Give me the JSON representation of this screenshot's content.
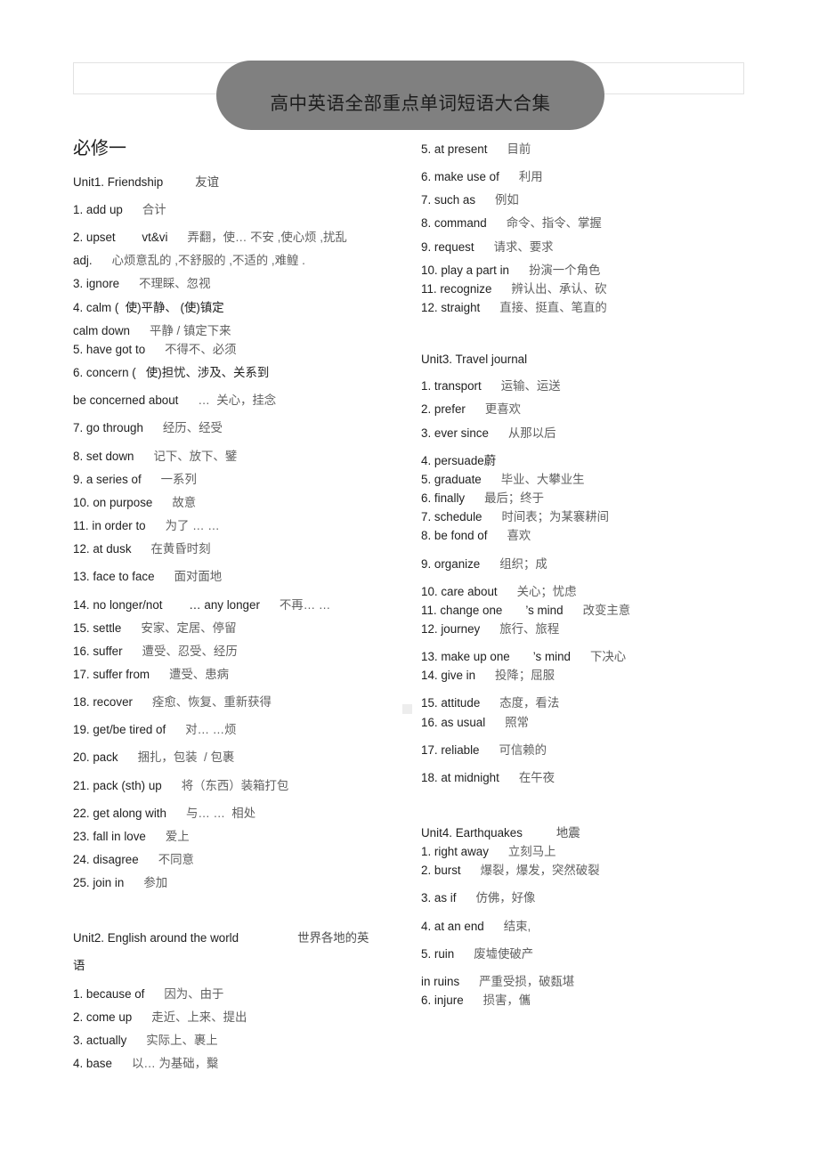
{
  "document": {
    "title_banner": "高中英语全部重点单词短语大合集",
    "banner_color": "#808080",
    "section_heading": "必修一"
  },
  "left_column": {
    "unit1": {
      "heading_en": "Unit1. Friendship",
      "heading_zh": "友谊",
      "entries": [
        {
          "en": "1. add up",
          "zh": "合计",
          "gap": "md"
        },
        {
          "en": "2. upset        vt&vi",
          "zh": "弄翻，使… 不安 ,使心烦 ,扰乱",
          "gap": "md"
        },
        {
          "en": "adj.",
          "zh": "心烦意乱的 ,不舒服的 ,不适的 ,难鳇 .",
          "gap": "sm"
        },
        {
          "en": "3. ignore",
          "zh": "不理睬、忽视",
          "gap": "sm"
        },
        {
          "en": "4. calm (  使)平静、 (使)镇定",
          "zh": "",
          "gap": "sm"
        },
        {
          "en": "calm down",
          "zh": "平静 / 镇定下来",
          "gap": "sm"
        },
        {
          "en": "5. have got to",
          "zh": "不得不、必须",
          "gap": "xs"
        },
        {
          "en": "6. concern (   使)担忧、涉及、关系到",
          "zh": "",
          "gap": "sm"
        },
        {
          "en": "be concerned about",
          "zh": "…  关心，挂念",
          "gap": "md"
        },
        {
          "en": "7. go through",
          "zh": "经历、经受",
          "gap": "md"
        },
        {
          "en": "8. set down",
          "zh": "记下、放下、鐾",
          "gap": "md"
        },
        {
          "en": "9. a series of",
          "zh": "一系列",
          "gap": "sm"
        },
        {
          "en": "10. on purpose",
          "zh": "故意",
          "gap": "sm"
        },
        {
          "en": "11. in order to",
          "zh": "为了 … …",
          "gap": "sm"
        },
        {
          "en": "12. at dusk",
          "zh": "在黄昏时刻",
          "gap": "sm"
        },
        {
          "en": "13. face to face",
          "zh": "面对面地",
          "gap": "md"
        },
        {
          "en": "14. no longer/not        … any longer",
          "zh": "不再… …",
          "gap": "md"
        },
        {
          "en": "15. settle",
          "zh": "安家、定居、停留",
          "gap": "sm"
        },
        {
          "en": "16. suffer",
          "zh": "遭受、忍受、经历",
          "gap": "sm"
        },
        {
          "en": "17. suffer from",
          "zh": "遭受、患病",
          "gap": "sm"
        },
        {
          "en": "18. recover",
          "zh": "痊愈、恢复、重新获得",
          "gap": "md"
        },
        {
          "en": "19. get/be tired of",
          "zh": "对… …烦",
          "gap": "md"
        },
        {
          "en": "20. pack",
          "zh": "捆扎，包装  / 包裹",
          "gap": "md"
        },
        {
          "en": "21. pack (sth) up",
          "zh": "将（东西）装箱打包",
          "gap": "md"
        },
        {
          "en": "22. get along with",
          "zh": "与… …  相处",
          "gap": "md"
        },
        {
          "en": "23. fall in love",
          "zh": "爱上",
          "gap": "sm"
        },
        {
          "en": "24. disagree",
          "zh": "不同意",
          "gap": "sm"
        },
        {
          "en": "25. join in",
          "zh": "参加",
          "gap": "sm"
        }
      ]
    },
    "unit2": {
      "heading_en": "Unit2. English around the world",
      "heading_zh": "世界各地的英",
      "heading_zh_wrap": "语",
      "entries": [
        {
          "en": "1. because of",
          "zh": "因为、由于",
          "gap": "md"
        },
        {
          "en": "2. come up",
          "zh": "走近、上来、提出",
          "gap": "sm"
        },
        {
          "en": "3. actually",
          "zh": "实际上、裹上",
          "gap": "sm"
        },
        {
          "en": "4. base",
          "zh": "以… 为基础，糳",
          "gap": "sm"
        }
      ]
    }
  },
  "right_column": {
    "unit2_cont": {
      "entries": [
        {
          "en": "5. at present",
          "zh": "目前",
          "gap": "none"
        },
        {
          "en": "6. make use of",
          "zh": "利用",
          "gap": "md"
        },
        {
          "en": "7. such as",
          "zh": "例如",
          "gap": "sm"
        },
        {
          "en": "8. command",
          "zh": "命令、指令、掌握",
          "gap": "sm"
        },
        {
          "en": "9. request",
          "zh": "请求、要求",
          "gap": "sm"
        },
        {
          "en": "10. play a part in",
          "zh": "扮演一个角色",
          "gap": "sm"
        },
        {
          "en": "11. recognize",
          "zh": "辨认出、承认、砍",
          "gap": "xs"
        },
        {
          "en": "12. straight",
          "zh": "直接、挺直、笔直的",
          "gap": "xs"
        }
      ]
    },
    "unit3": {
      "heading_en": "Unit3. Travel journal",
      "heading_zh": "",
      "entries": [
        {
          "en": "1. transport",
          "zh": "运输、运送",
          "gap": "md"
        },
        {
          "en": "2. prefer",
          "zh": "更喜欢",
          "gap": "sm"
        },
        {
          "en": "3. ever since",
          "zh": "从那以后",
          "gap": "sm"
        },
        {
          "en": "4. persuade蔚",
          "zh": "",
          "gap": "md"
        },
        {
          "en": "5. graduate",
          "zh": "毕业、大攀业生",
          "gap": "xs"
        },
        {
          "en": "6. finally",
          "zh": "最后；终于",
          "gap": "xs"
        },
        {
          "en": "7. schedule",
          "zh": "时间表；为某褰耕间",
          "gap": "xs"
        },
        {
          "en": "8. be fond of",
          "zh": "喜欢",
          "gap": "xs"
        },
        {
          "en": "9. organize",
          "zh": "组织；成",
          "gap": "md"
        },
        {
          "en": "10. care about",
          "zh": "关心；忧虑",
          "gap": "md"
        },
        {
          "en": "11. change one       ’s mind",
          "zh": "改变主意",
          "gap": "xs"
        },
        {
          "en": "12. journey",
          "zh": "旅行、旅程",
          "gap": "xs"
        },
        {
          "en": "13. make up one       ’s mind",
          "zh": "下决心",
          "gap": "md"
        },
        {
          "en": "14. give in",
          "zh": "投降；屈服",
          "gap": "xs"
        },
        {
          "en": "15. attitude",
          "zh": "态度，看法",
          "gap": "md"
        },
        {
          "en": "16. as usual",
          "zh": "照常",
          "gap": "xs"
        },
        {
          "en": "17. reliable",
          "zh": "可信赖的",
          "gap": "md"
        },
        {
          "en": "18. at midnight",
          "zh": "在午夜",
          "gap": "md"
        }
      ]
    },
    "unit4": {
      "heading_en": "Unit4. Earthquakes",
      "heading_zh": "地震",
      "entries": [
        {
          "en": "1. right away",
          "zh": "立刻马上",
          "gap": "xs"
        },
        {
          "en": "2. burst",
          "zh": "爆裂，爆发，突然破裂",
          "gap": "xs"
        },
        {
          "en": "3. as if",
          "zh": "仿佛，好像",
          "gap": "md"
        },
        {
          "en": "4. at an end",
          "zh": "结束,",
          "gap": "md"
        },
        {
          "en": "5. ruin",
          "zh": "废墟使破产",
          "gap": "md"
        },
        {
          "en": "in ruins",
          "zh": "严重受损，破瓾堪",
          "gap": "md"
        },
        {
          "en": "6. injure",
          "zh": "损害，儶",
          "gap": "xs"
        }
      ]
    }
  }
}
